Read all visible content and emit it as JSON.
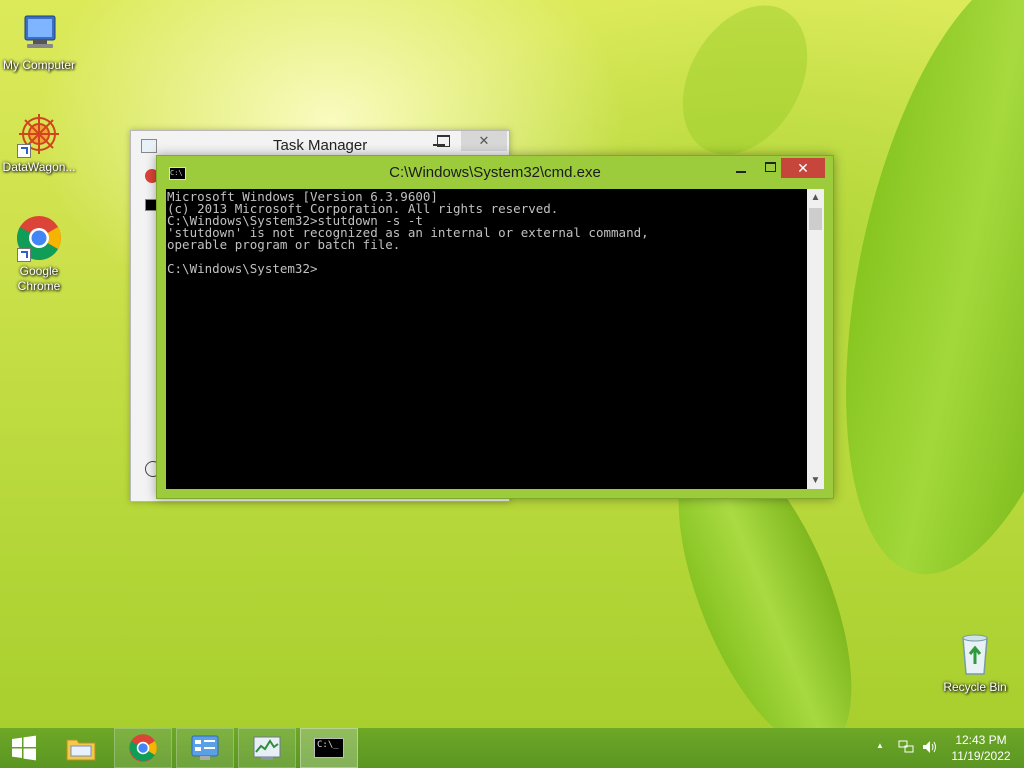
{
  "desktop": {
    "icons": [
      {
        "name": "my-computer",
        "label": "My Computer"
      },
      {
        "name": "datawagon",
        "label": "DataWagon..."
      },
      {
        "name": "google-chrome",
        "label": "Google Chrome"
      },
      {
        "name": "recycle-bin",
        "label": "Recycle Bin"
      }
    ]
  },
  "task_manager": {
    "title": "Task Manager",
    "close_glyph": "✕"
  },
  "cmd": {
    "title": "C:\\Windows\\System32\\cmd.exe",
    "icon_text": "C:\\",
    "close_glyph": "✕",
    "console_lines": "Microsoft Windows [Version 6.3.9600]\n(c) 2013 Microsoft Corporation. All rights reserved.\nC:\\Windows\\System32>stutdown -s -t\n'stutdown' is not recognized as an internal or external command,\noperable program or batch file.\n\nC:\\Windows\\System32>",
    "scroll_up_glyph": "▲",
    "scroll_down_glyph": "▼"
  },
  "taskbar": {
    "apps": [
      {
        "name": "file-explorer",
        "state": "pinned"
      },
      {
        "name": "google-chrome",
        "state": "open"
      },
      {
        "name": "control-panel",
        "state": "open"
      },
      {
        "name": "task-manager",
        "state": "open"
      },
      {
        "name": "command-prompt",
        "state": "active"
      }
    ],
    "cmd_icon_text": "C:\\_",
    "tray_chevron": "▲",
    "clock_time": "12:43 PM",
    "clock_date": "11/19/2022"
  },
  "colors": {
    "cmd_frame": "#9ccc3c",
    "close_red": "#c7463c",
    "taskbar": "#5b9622",
    "console_text": "#c0c0c0"
  }
}
